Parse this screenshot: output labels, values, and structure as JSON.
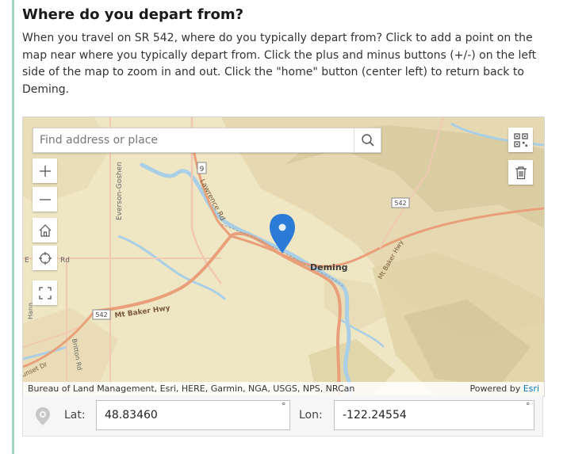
{
  "question": {
    "title": "Where do you depart from?",
    "description": "When you travel on SR 542, where do you typically depart from? Click to add a point on the map near where you typically depart from. Click the plus and minus buttons (+/-) on the left side of the map to zoom in and out. Click the \"home\" button (center left) to return back to Deming."
  },
  "map": {
    "search_placeholder": "Find address or place",
    "labels": {
      "deming": "Deming",
      "mt_baker_hwy": "Mt Baker Hwy",
      "mt_baker_hwy_east": "Mt Baker Hwy",
      "everson_goshen": "Everson-Goshen",
      "lawrence_rd": "Lawrence Rd",
      "britton_rd": "Britton Rd",
      "sunset_dr": "unset Dr",
      "hann": "Hann",
      "rd": "Rd",
      "e_prefix": "E",
      "shield_542_a": "542",
      "shield_542_b": "542",
      "shield_9": "9"
    },
    "attribution": "Bureau of Land Management, Esri, HERE, Garmin, NGA, USGS, NPS, NRCan",
    "powered_by": "Powered by",
    "powered_by_link": "Esri",
    "icons": [
      "search-icon",
      "zoom-in-icon",
      "zoom-out-icon",
      "home-icon",
      "locate-icon",
      "fullscreen-icon",
      "qr-code-icon",
      "trash-icon",
      "map-pin-icon"
    ]
  },
  "coords": {
    "lat_label": "Lat:",
    "lat_value": "48.83460",
    "lon_label": "Lon:",
    "lon_value": "-122.24554",
    "degree_symbol": "°"
  },
  "colors": {
    "accent": "#9fd7bf",
    "pin": "#2a7ad6",
    "road": "#e9a07a",
    "river": "#a9cfe6",
    "esri_link": "#0079c1"
  }
}
